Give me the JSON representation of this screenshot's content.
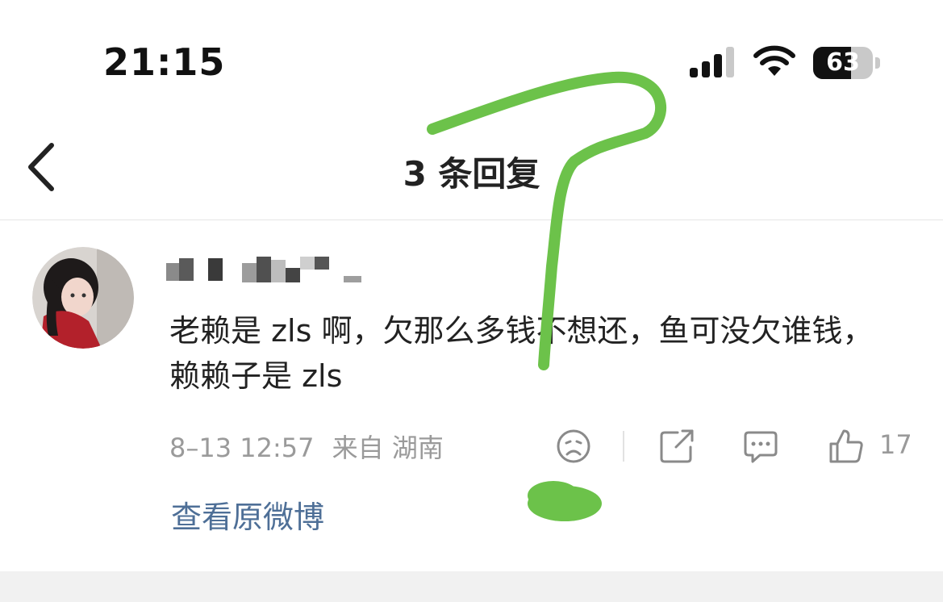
{
  "status_bar": {
    "time": "21:15",
    "battery": "63",
    "battery_level": 0.63,
    "icons": [
      "cellular-signal-icon",
      "wifi-icon",
      "battery-icon"
    ]
  },
  "nav": {
    "back_icon": "chevron-left-icon",
    "title": "3 条回复"
  },
  "comment": {
    "text": "老赖是 zls 啊，欠那么多钱不想还，鱼可没欠谁钱，赖赖子是 zls",
    "date": "8–13 12:57",
    "source": "来自 湖南",
    "like_count": "17",
    "icons": [
      "dislike-face-icon",
      "share-icon",
      "comment-icon",
      "thumbs-up-icon"
    ]
  },
  "link": {
    "view_original": "查看原微博"
  },
  "colors": {
    "link": "#4e6f97",
    "meta": "#9a9a9a",
    "annotation": "#6cc24a"
  }
}
